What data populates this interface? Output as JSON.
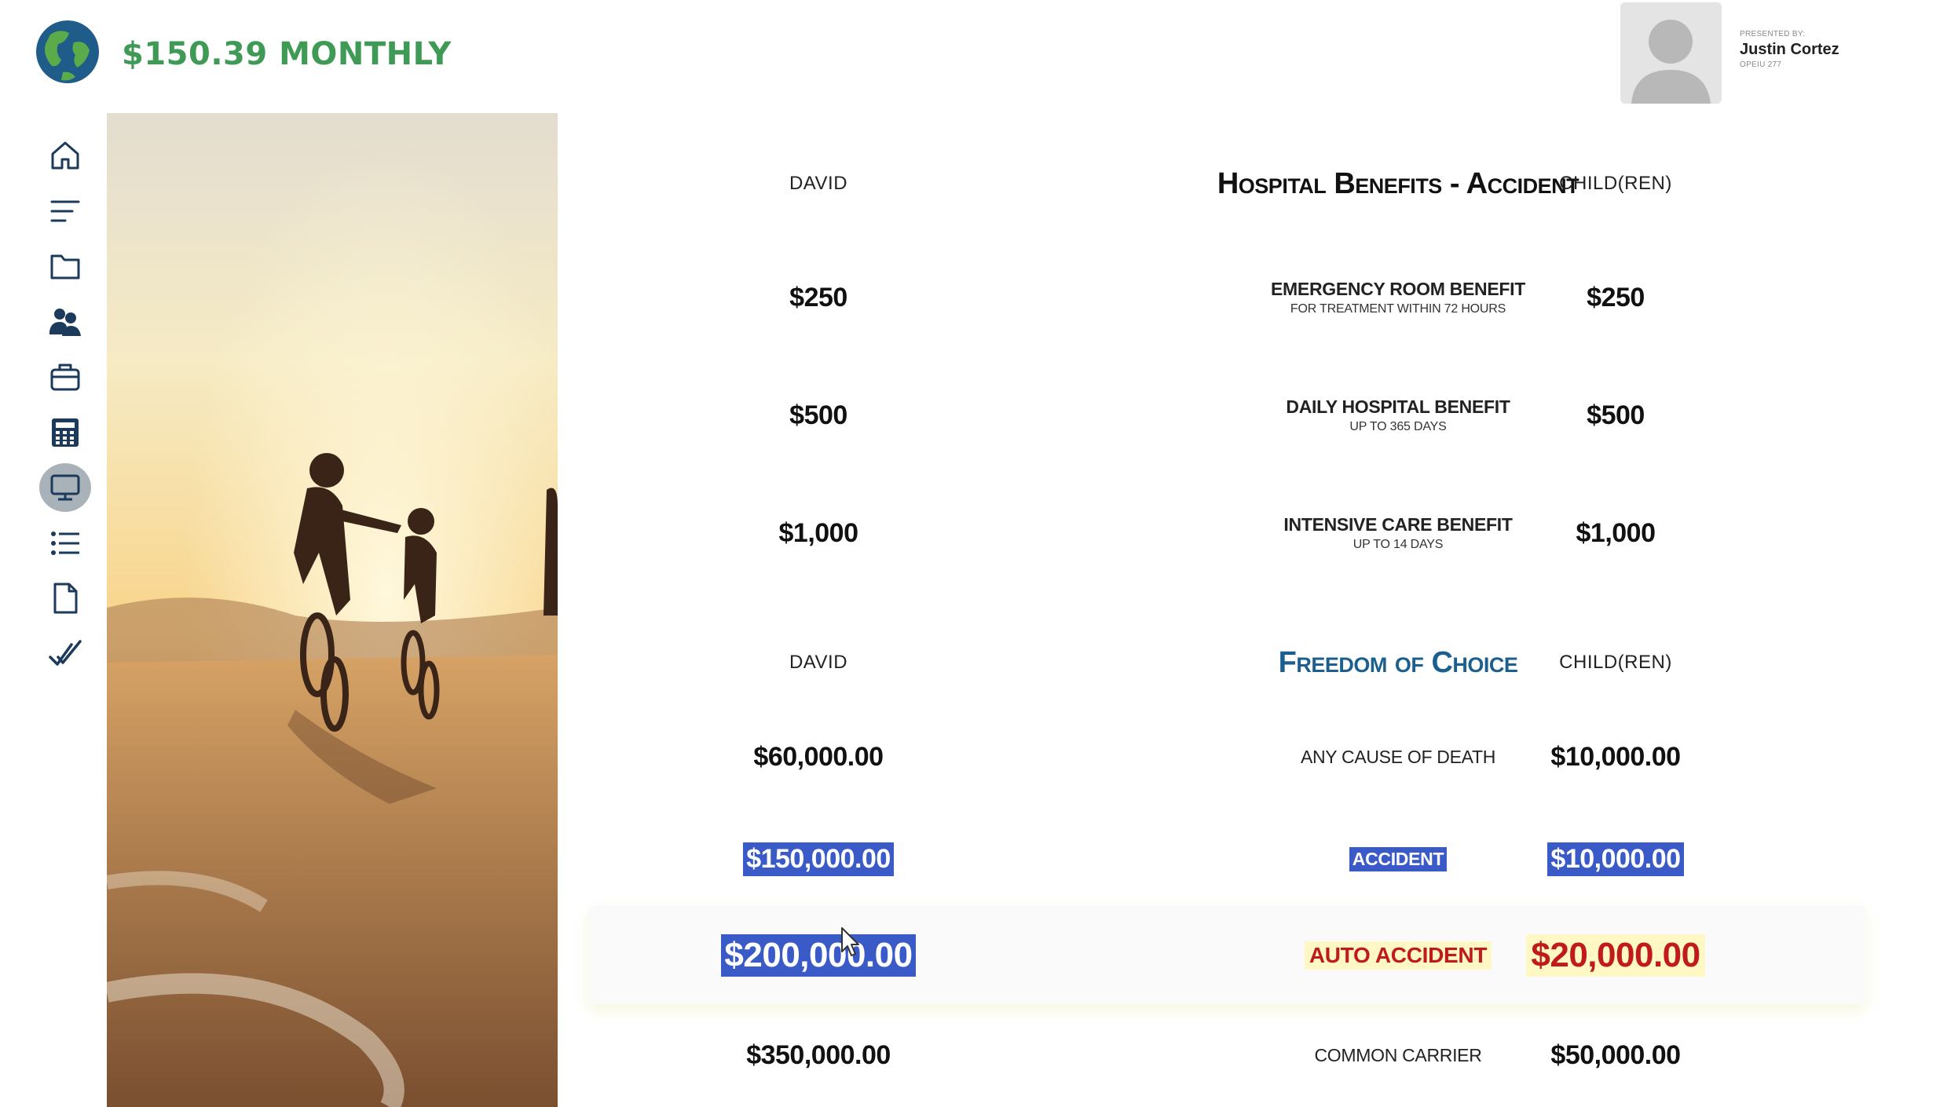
{
  "header": {
    "monthly_label": "$150.39 MONTHLY",
    "presenter_caption": "PRESENTED BY:",
    "presenter_name": "Justin Cortez",
    "presenter_id": "OPEIU 277"
  },
  "sidebar": {
    "items": [
      {
        "name": "home-icon",
        "active": false
      },
      {
        "name": "menu-lines-icon",
        "active": false
      },
      {
        "name": "folder-icon",
        "active": false
      },
      {
        "name": "people-icon",
        "active": false
      },
      {
        "name": "briefcase-icon",
        "active": false
      },
      {
        "name": "calculator-icon",
        "active": false
      },
      {
        "name": "monitor-icon",
        "active": true
      },
      {
        "name": "list-icon",
        "active": false
      },
      {
        "name": "document-icon",
        "active": false
      },
      {
        "name": "double-check-icon",
        "active": false
      }
    ]
  },
  "section1": {
    "left_header": "DAVID",
    "title": "Hospital Benefits - Accident",
    "right_header": "CHILD(REN)",
    "rows": [
      {
        "left": "$250",
        "label": "EMERGENCY ROOM BENEFIT",
        "sub": "FOR TREATMENT WITHIN 72 HOURS",
        "right": "$250"
      },
      {
        "left": "$500",
        "label": "DAILY HOSPITAL BENEFIT",
        "sub": "UP TO 365 DAYS",
        "right": "$500"
      },
      {
        "left": "$1,000",
        "label": "INTENSIVE CARE BENEFIT",
        "sub": "UP TO 14 DAYS",
        "right": "$1,000"
      }
    ]
  },
  "section2": {
    "left_header": "DAVID",
    "title": "Freedom of Choice",
    "right_header": "CHILD(REN)",
    "rows": [
      {
        "left": "$60,000.00",
        "label": "ANY CAUSE OF DEATH",
        "right": "$10,000.00"
      },
      {
        "left": "$150,000.00",
        "label": "ACCIDENT",
        "right": "$10,000.00"
      },
      {
        "left": "$200,000.00",
        "label": "AUTO ACCIDENT",
        "right": "$20,000.00"
      },
      {
        "left": "$350,000.00",
        "label": "COMMON CARRIER",
        "right": "$50,000.00"
      }
    ]
  },
  "colors": {
    "brand_green": "#3f9a55",
    "title_blue": "#1b5f8f",
    "selection_blue": "#3a5bc7",
    "alert_red": "#c01a1a",
    "highlight_yellow": "#fff7c4"
  }
}
